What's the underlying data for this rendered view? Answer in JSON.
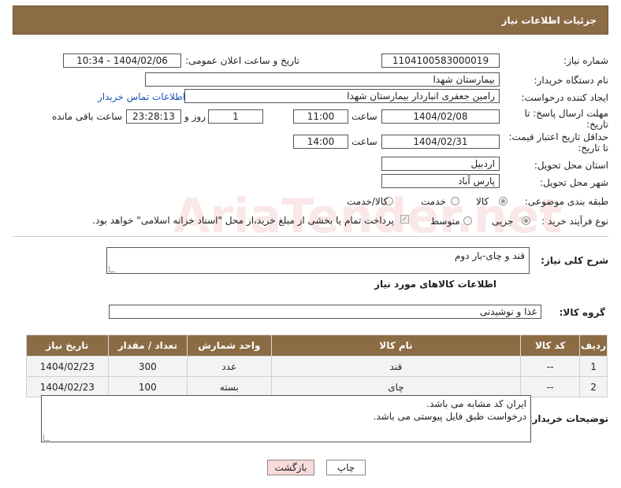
{
  "header": {
    "title": "جزئیات اطلاعات نیاز"
  },
  "fields": {
    "need_number": {
      "label": "شماره نیاز:",
      "value": "1104100583000019"
    },
    "announce_datetime": {
      "label": "تاریخ و ساعت اعلان عمومی:",
      "value": "1404/02/06 - 10:34"
    },
    "buyer_org": {
      "label": "نام دستگاه خریدار:",
      "value": "بیمارستان شهدا"
    },
    "requester": {
      "label": "ایجاد کننده درخواست:",
      "value": "رامین جعفری انباردار بیمارستان شهدا",
      "contact_link": "اطلاعات تماس خریدار"
    },
    "reply_deadline": {
      "label_line1": "مهلت ارسال پاسخ: تا",
      "label_line2": "تاریخ:",
      "date": "1404/02/08",
      "time_label": "ساعت",
      "time": "11:00",
      "days": "1",
      "days_label": "روز و",
      "remaining": "23:28:13",
      "remaining_label": "ساعت باقی مانده"
    },
    "price_validity": {
      "label_line1": "حداقل تاریخ اعتبار قیمت:",
      "label_line2": "تا تاریخ:",
      "date": "1404/02/31",
      "time_label": "ساعت",
      "time": "14:00"
    },
    "province": {
      "label": "استان محل تحویل:",
      "value": "اردبیل"
    },
    "city": {
      "label": "شهر محل تحویل:",
      "value": "پارس آباد"
    },
    "category": {
      "label": "طبقه بندی موضوعی:",
      "options": [
        "کالا",
        "خدمت",
        "کالا/خدمت"
      ],
      "selected": "کالا"
    },
    "process_type": {
      "label": "نوع فرآیند خرید :",
      "options": [
        "جزیی",
        "متوسط"
      ],
      "selected": "جزیی",
      "payment_note": "پرداخت تمام یا بخشی از مبلغ خرید،از محل \"اسناد خزانه اسلامی\" خواهد بود."
    }
  },
  "general_desc": {
    "label": "شرح کلی نیاز:",
    "value": "قند و چای-بار دوم"
  },
  "items_section": {
    "title": "اطلاعات کالاهای مورد نیاز",
    "group_label": "گروه کالا:",
    "group_value": "غذا و نوشیدنی"
  },
  "table": {
    "headers": [
      "ردیف",
      "کد کالا",
      "نام کالا",
      "واحد شمارش",
      "تعداد / مقدار",
      "تاریخ نیاز"
    ],
    "rows": [
      [
        "1",
        "--",
        "قند",
        "عدد",
        "300",
        "1404/02/23"
      ],
      [
        "2",
        "--",
        "چای",
        "بسته",
        "100",
        "1404/02/23"
      ]
    ]
  },
  "buyer_notes": {
    "label": "توضیحات خریدار:",
    "line1": "ایران کد مشابه می باشد.",
    "line2": "درخواست طبق فایل پیوستی می باشد."
  },
  "buttons": {
    "print": "چاپ",
    "back": "بازگشت"
  },
  "watermark": {
    "text": "AriaTender.net"
  },
  "colors": {
    "header_bg": "#8b6c45",
    "link": "#1a55b5",
    "back_button_bg": "#f8dada"
  }
}
